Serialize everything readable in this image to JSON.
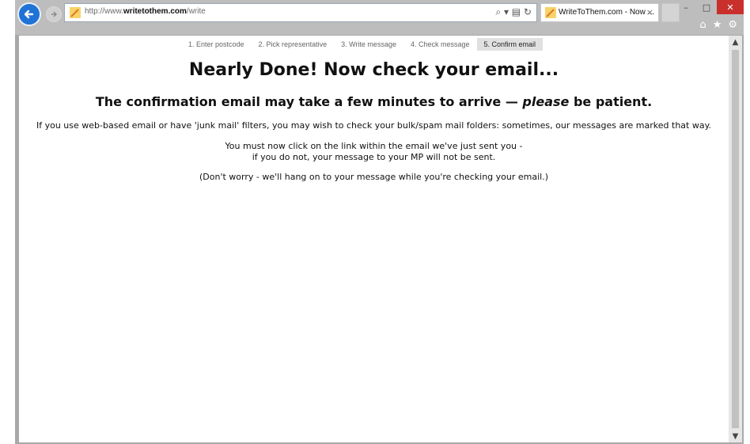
{
  "browser": {
    "url_prefix": "http://www.",
    "url_domain": "writetothem.com",
    "url_path": "/write",
    "address_tools": "⌕ ▾ ▤ ↻",
    "tab_title": "WriteToThem.com - Now ...",
    "tab_close": "×",
    "window_buttons": [
      "–",
      "□",
      "✕"
    ],
    "toolbar_icons": [
      "⌂",
      "★",
      "⚙"
    ]
  },
  "steps": [
    {
      "label": "1. Enter postcode",
      "active": false
    },
    {
      "label": "2. Pick representative",
      "active": false
    },
    {
      "label": "3. Write message",
      "active": false
    },
    {
      "label": "4. Check message",
      "active": false
    },
    {
      "label": "5. Confirm email",
      "active": true
    }
  ],
  "content": {
    "heading": "Nearly Done! Now check your email...",
    "subheading_pre": "The confirmation email may take a few minutes to arrive — ",
    "subheading_em": "please",
    "subheading_post": " be patient.",
    "para1": "If you use web-based email or have 'junk mail' filters, you may wish to check your bulk/spam mail folders: sometimes, our messages are marked that way.",
    "para2_line1": "You must now click on the link within the email we've just sent you -",
    "para2_line2": "if you do not, your message to your MP will not be sent.",
    "para3": "(Don't worry - we'll hang on to your message while you're checking your email.)"
  },
  "colors": {
    "back_button": "#1f73d6",
    "close_button": "#c9302c"
  }
}
